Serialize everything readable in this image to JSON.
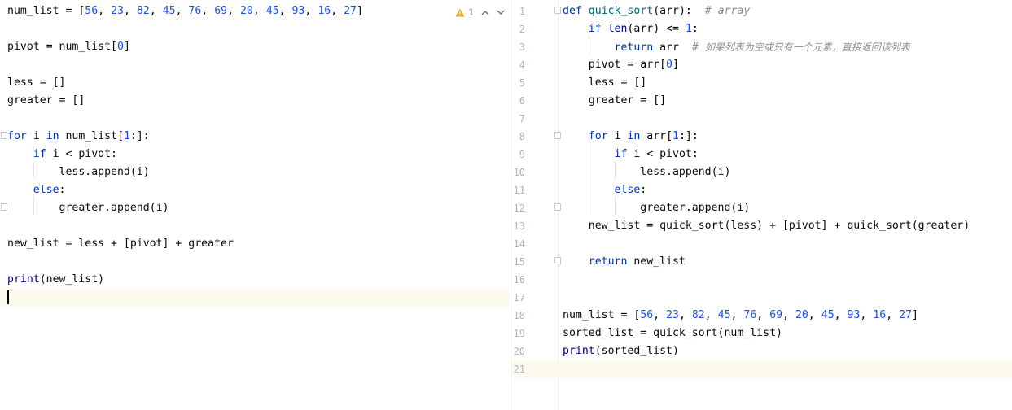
{
  "left_editor": {
    "inspection": {
      "warning_count": "1",
      "icon": "warning-icon"
    },
    "lines": [
      [
        [
          "num_list = [",
          ""
        ],
        [
          "56",
          "num"
        ],
        [
          ", ",
          ""
        ],
        [
          "23",
          "num"
        ],
        [
          ", ",
          ""
        ],
        [
          "82",
          "num"
        ],
        [
          ", ",
          ""
        ],
        [
          "45",
          "num"
        ],
        [
          ", ",
          ""
        ],
        [
          "76",
          "num"
        ],
        [
          ", ",
          ""
        ],
        [
          "69",
          "num"
        ],
        [
          ", ",
          ""
        ],
        [
          "20",
          "num"
        ],
        [
          ", ",
          ""
        ],
        [
          "45",
          "num"
        ],
        [
          ", ",
          ""
        ],
        [
          "93",
          "num"
        ],
        [
          ", ",
          ""
        ],
        [
          "16",
          "num"
        ],
        [
          ", ",
          ""
        ],
        [
          "27",
          "num"
        ],
        [
          "]",
          ""
        ]
      ],
      [],
      [
        [
          "pivot = num_list[",
          ""
        ],
        [
          "0",
          "num"
        ],
        [
          "]",
          ""
        ]
      ],
      [],
      [
        [
          "less = []",
          ""
        ]
      ],
      [
        [
          "greater = []",
          ""
        ]
      ],
      [],
      [
        [
          "for",
          "kw"
        ],
        [
          " i ",
          ""
        ],
        [
          "in",
          "kw"
        ],
        [
          " num_list[",
          ""
        ],
        [
          "1",
          "num"
        ],
        [
          ":]:",
          ""
        ]
      ],
      [
        [
          "    ",
          ""
        ],
        [
          "if",
          "kw"
        ],
        [
          " i < pivot:",
          ""
        ]
      ],
      [
        [
          "        less.append(i)",
          ""
        ]
      ],
      [
        [
          "    ",
          ""
        ],
        [
          "else",
          "kw"
        ],
        [
          ":",
          ""
        ]
      ],
      [
        [
          "        greater.append(i)",
          ""
        ]
      ],
      [],
      [
        [
          "new_list = less + [pivot] + greater",
          ""
        ]
      ],
      [],
      [
        [
          "print",
          "bi"
        ],
        [
          "(new_list)",
          ""
        ]
      ],
      []
    ]
  },
  "right_editor": {
    "line_numbers": [
      "1",
      "2",
      "3",
      "4",
      "5",
      "6",
      "7",
      "8",
      "9",
      "10",
      "11",
      "12",
      "13",
      "14",
      "15",
      "16",
      "17",
      "18",
      "19",
      "20",
      "21"
    ],
    "lines": [
      [
        [
          "def",
          "kw"
        ],
        [
          " ",
          ""
        ],
        [
          "quick_sort",
          "fn"
        ],
        [
          "(arr):  ",
          ""
        ],
        [
          "# array",
          "cm"
        ]
      ],
      [
        [
          "    ",
          ""
        ],
        [
          "if",
          "kw"
        ],
        [
          " ",
          ""
        ],
        [
          "len",
          "bi"
        ],
        [
          "(arr) <= ",
          ""
        ],
        [
          "1",
          "num"
        ],
        [
          ":",
          ""
        ]
      ],
      [
        [
          "        ",
          ""
        ],
        [
          "return",
          "kw"
        ],
        [
          " arr  ",
          ""
        ],
        [
          "# ",
          "cm"
        ],
        [
          "如果列表为空或只有一个元素，直接返回该列表",
          "cmcjk"
        ]
      ],
      [
        [
          "    pivot = arr[",
          ""
        ],
        [
          "0",
          "num"
        ],
        [
          "]",
          ""
        ]
      ],
      [
        [
          "    less = []",
          ""
        ]
      ],
      [
        [
          "    greater = []",
          ""
        ]
      ],
      [],
      [
        [
          "    ",
          ""
        ],
        [
          "for",
          "kw"
        ],
        [
          " i ",
          ""
        ],
        [
          "in",
          "kw"
        ],
        [
          " arr[",
          ""
        ],
        [
          "1",
          "num"
        ],
        [
          ":]:",
          ""
        ]
      ],
      [
        [
          "        ",
          ""
        ],
        [
          "if",
          "kw"
        ],
        [
          " i < pivot:",
          ""
        ]
      ],
      [
        [
          "            less.append(i)",
          ""
        ]
      ],
      [
        [
          "        ",
          ""
        ],
        [
          "else",
          "kw"
        ],
        [
          ":",
          ""
        ]
      ],
      [
        [
          "            greater.append(i)",
          ""
        ]
      ],
      [
        [
          "    new_list = quick_sort(less) + [pivot] + quick_sort(greater)",
          ""
        ]
      ],
      [],
      [
        [
          "    ",
          ""
        ],
        [
          "return",
          "kw"
        ],
        [
          " new_list",
          ""
        ]
      ],
      [],
      [],
      [
        [
          "num_list = [",
          ""
        ],
        [
          "56",
          "num"
        ],
        [
          ", ",
          ""
        ],
        [
          "23",
          "num"
        ],
        [
          ", ",
          ""
        ],
        [
          "82",
          "num"
        ],
        [
          ", ",
          ""
        ],
        [
          "45",
          "num"
        ],
        [
          ", ",
          ""
        ],
        [
          "76",
          "num"
        ],
        [
          ", ",
          ""
        ],
        [
          "69",
          "num"
        ],
        [
          ", ",
          ""
        ],
        [
          "20",
          "num"
        ],
        [
          ", ",
          ""
        ],
        [
          "45",
          "num"
        ],
        [
          ", ",
          ""
        ],
        [
          "93",
          "num"
        ],
        [
          ", ",
          ""
        ],
        [
          "16",
          "num"
        ],
        [
          ", ",
          ""
        ],
        [
          "27",
          "num"
        ],
        [
          "]",
          ""
        ]
      ],
      [
        [
          "sorted_list = quick_sort(num_list)",
          ""
        ]
      ],
      [
        [
          "print",
          "bi"
        ],
        [
          "(sorted_list)",
          ""
        ]
      ],
      []
    ]
  },
  "colors": {
    "keyword": "#0033b3",
    "number": "#1750eb",
    "builtin": "#000080",
    "function_name": "#00627a",
    "comment": "#8c8c8c",
    "current_line": "#fcfaed",
    "warning": "#e3a82b"
  }
}
